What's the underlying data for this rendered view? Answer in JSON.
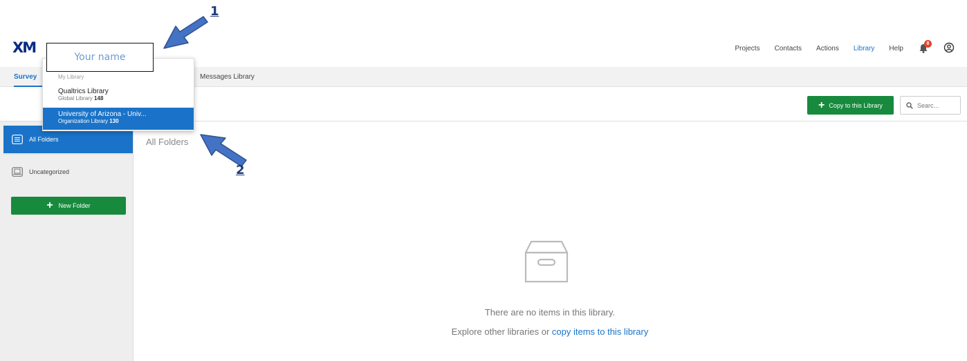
{
  "logo": "XM",
  "topnav": {
    "items": [
      "Projects",
      "Contacts",
      "Actions",
      "Library",
      "Help"
    ],
    "active": "Library",
    "notification_count": "8"
  },
  "tabs": {
    "survey_library": "Survey L",
    "messages_library": "Messages Library"
  },
  "toolbar": {
    "copy_label": "Copy to this Library",
    "search_placeholder": "Searc..."
  },
  "sidebar": {
    "all_folders": "All Folders",
    "uncategorized": "Uncategorized",
    "new_folder": "New Folder"
  },
  "main": {
    "title": "All Folders",
    "empty_message": "There are no items in this library.",
    "explore_prefix": "Explore other libraries or ",
    "explore_link": "copy items to this library"
  },
  "dropdown": {
    "name_placeholder": "Your name",
    "my_library": "My Library",
    "items": [
      {
        "name": "Qualtrics Library",
        "sub_label": "Global Library",
        "count": "148",
        "selected": false
      },
      {
        "name": "University of Arizona - Univ...",
        "sub_label": "Organization Library",
        "count": "130",
        "selected": true
      }
    ]
  },
  "annotations": {
    "step1": "1",
    "step2": "2"
  },
  "colors": {
    "accent": "#1a73c8",
    "primary_button": "#178a3e",
    "annotation_arrow": "#4472c4"
  }
}
